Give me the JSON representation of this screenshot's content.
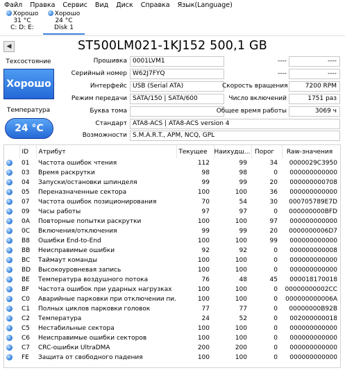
{
  "menu": [
    "Файл",
    "Правка",
    "Сервис",
    "Вид",
    "Диск",
    "Справка",
    "Язык(Language)"
  ],
  "disks": [
    {
      "status": "Хорошо",
      "temp": "31 °C",
      "name": "C: D: E:"
    },
    {
      "status": "Хорошо",
      "temp": "24 °C",
      "name": "Disk 1"
    }
  ],
  "nav_back": "◀",
  "title": "ST500LM021-1KJ152 500,1 GB",
  "health": {
    "label": "Техсостояние",
    "value": "Хорошо"
  },
  "temperature": {
    "label": "Температура",
    "value": "24 °C"
  },
  "info": {
    "firmware_label": "Прошивка",
    "firmware": "0001LVM1",
    "serial_label": "Серийный номер",
    "serial": "W62J7FYQ",
    "interface_label": "Интерфейс",
    "interface": "USB (Serial ATA)",
    "transfer_label": "Режим передачи",
    "transfer": "SATA/150 | SATA/600",
    "drive_letter_label": "Буква тома",
    "drive_letter": "",
    "standard_label": "Стандарт",
    "standard": "ATA8-ACS | ATA8-ACS version 4",
    "features_label": "Возможности",
    "features": "S.M.A.R.T., APM, NCQ, GPL",
    "r1_label": "----",
    "r1_value": "----",
    "r2_label": "----",
    "r2_value": "----",
    "rpm_label": "Скорость вращения",
    "rpm": "7200 RPM",
    "power_on_count_label": "Число включений",
    "power_on_count": "1751 раз",
    "power_on_hours_label": "Общее время работы",
    "power_on_hours": "3069 ч"
  },
  "smart": {
    "headers": [
      "ID",
      "Атрибут",
      "Текущее",
      "Наихудш...",
      "Порог",
      "Raw-значения"
    ],
    "rows": [
      [
        "01",
        "Частота ошибок чтения",
        "112",
        "99",
        "34",
        "0000029C3950"
      ],
      [
        "03",
        "Время раскрутки",
        "98",
        "98",
        "0",
        "000000000000"
      ],
      [
        "04",
        "Запуски/остановки шпинделя",
        "99",
        "99",
        "20",
        "000000000708"
      ],
      [
        "05",
        "Переназначенные сектора",
        "100",
        "100",
        "36",
        "000000000000"
      ],
      [
        "07",
        "Частота ошибок позиционирования",
        "70",
        "54",
        "30",
        "000705789E7D"
      ],
      [
        "09",
        "Часы работы",
        "97",
        "97",
        "0",
        "000000000BFD"
      ],
      [
        "0A",
        "Повторные попытки раскрутки",
        "100",
        "100",
        "97",
        "000000000000"
      ],
      [
        "0C",
        "Включения/отключения",
        "99",
        "99",
        "20",
        "0000000006D7"
      ],
      [
        "B8",
        "Ошибки End-to-End",
        "100",
        "100",
        "99",
        "000000000000"
      ],
      [
        "BB",
        "Неисправимые ошибки",
        "92",
        "92",
        "0",
        "000000000008"
      ],
      [
        "BC",
        "Таймаут команды",
        "100",
        "100",
        "0",
        "000000000000"
      ],
      [
        "BD",
        "Высокоуровневая запись",
        "100",
        "100",
        "0",
        "000000000000"
      ],
      [
        "BE",
        "Температура воздушного потока",
        "76",
        "48",
        "45",
        "000018170018"
      ],
      [
        "BF",
        "Частота ошибок при ударных нагрузках",
        "100",
        "100",
        "0",
        "00000000002CC"
      ],
      [
        "C0",
        "Аварийные парковки при отключении пи...",
        "100",
        "100",
        "0",
        "000000000006A"
      ],
      [
        "C1",
        "Полных циклов парковки головок",
        "77",
        "77",
        "0",
        "00000000B92B"
      ],
      [
        "C2",
        "Температура",
        "24",
        "52",
        "0",
        "002000000018"
      ],
      [
        "C5",
        "Нестабильные сектора",
        "100",
        "100",
        "0",
        "000000000000"
      ],
      [
        "C6",
        "Неисправимые ошибки секторов",
        "100",
        "100",
        "0",
        "000000000000"
      ],
      [
        "C7",
        "CRC-ошибки UltraDMA",
        "200",
        "200",
        "0",
        "000000000000"
      ],
      [
        "FE",
        "Защита от свободного падения",
        "100",
        "100",
        "0",
        "000000000000"
      ]
    ]
  }
}
